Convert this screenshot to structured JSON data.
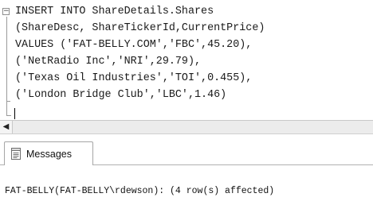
{
  "editor": {
    "code_lines": [
      "INSERT INTO ShareDetails.Shares",
      "(ShareDesc, ShareTickerId,CurrentPrice)",
      "VALUES ('FAT-BELLY.COM','FBC',45.20),",
      "('NetRadio Inc','NRI',29.79),",
      "('Texas Oil Industries','TOI',0.455),",
      "('London Bridge Club','LBC',1.46)"
    ],
    "collapse_glyph": "−"
  },
  "scrollbar": {
    "left_arrow": "◀"
  },
  "results": {
    "tab_label": "Messages",
    "tab_icon": "messages-icon",
    "message": "FAT-BELLY(FAT-BELLY\\rdewson): (4 row(s) affected)"
  },
  "colors": {
    "background": "#ffffff",
    "code_text": "#1a1a1a",
    "outline": "#9a9a9a",
    "scroll_track": "#ececec"
  }
}
